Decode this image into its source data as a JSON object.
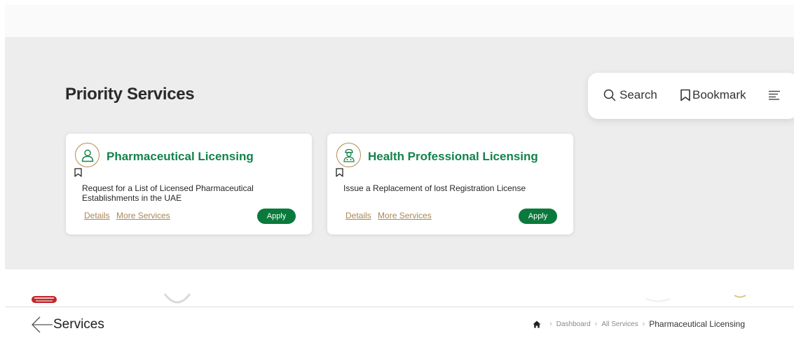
{
  "priority_section": {
    "title": "Priority Services"
  },
  "floating_bar": {
    "search_label": "Search",
    "bookmark_label": "Bookmark",
    "icons": [
      "search-icon",
      "bookmark-icon",
      "menu-lines-icon"
    ]
  },
  "cards": [
    {
      "title": "Pharmaceutical Licensing",
      "icon": "user-outline-icon",
      "description": "Request for a List of Licensed Pharmaceutical Establishments in the UAE",
      "details_label": "Details",
      "more_services_label": "More Services",
      "apply_label": "Apply"
    },
    {
      "title": "Health Professional Licensing",
      "icon": "doctor-icon",
      "description": "Issue a Replacement of lost Registration License",
      "details_label": "Details",
      "more_services_label": "More Services",
      "apply_label": "Apply"
    }
  ],
  "page_header": {
    "title": "Services",
    "back_icon": "back-arrow-icon"
  },
  "breadcrumb": {
    "home_icon": "home-icon",
    "items": [
      "Dashboard",
      "All Services"
    ],
    "current": "Pharmaceutical Licensing"
  },
  "colors": {
    "brand_green": "#13834a",
    "apply_green": "#0a7a3c",
    "gold_accent": "#b28b4c",
    "link_gold": "#a98755",
    "band_gray": "#ededed"
  }
}
